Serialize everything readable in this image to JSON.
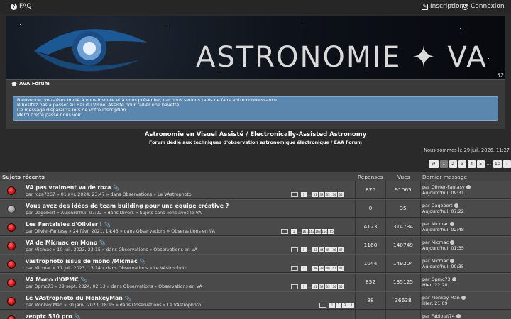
{
  "topbar": {
    "faq": "FAQ",
    "register": "Inscription",
    "login": "Connexion"
  },
  "banner": {
    "title": "ASTRONOMIE ✦ VA",
    "badge": "52"
  },
  "breadcrumb": {
    "home": "AVA Forum"
  },
  "notice": {
    "lines": [
      "Bienvenue, vous êtes invité à vous inscrire et à vous présenter, car nous serions ravis de faire votre connaissance.",
      "N'hésitez pas à passer au Bar du Visuel Assisté pour tailler une bavette",
      "Ce message disparaitra lors de votre inscription.",
      "Merci d'être passé nous voir"
    ]
  },
  "site": {
    "title": "Astronomie en Visuel Assisté / Electronically-Assisted Astronomy",
    "description": "Forum dédié aux techniques d'observation astronomique électronique / EAA Forum",
    "date": "Nous sommes le 29 juil. 2026, 11:27"
  },
  "pagination": {
    "pages": [
      "1",
      "2",
      "3",
      "4",
      "5",
      "…",
      "10"
    ],
    "current": "1"
  },
  "columns": {
    "topics": "Sujets récents",
    "replies": "Réponses",
    "views": "Vues",
    "last": "Dernier message"
  },
  "topics": [
    {
      "title": "VA pas vraiment va de roza",
      "attach": true,
      "meta": "par roza7267 » 01 avr. 2024, 23:47 » dans Observations » Le VAstrophoto",
      "pages": [
        "1",
        "…",
        "31",
        "32",
        "33",
        "34",
        "35"
      ],
      "replies": "870",
      "views": "91065",
      "last_by": "par Olivier-Fantasy",
      "last_time": "Aujourd'hui, 09:31",
      "unread": true
    },
    {
      "title": "Vous avez des idées de team building pour une équipe créative ?",
      "attach": false,
      "meta": "par Dagobert » Aujourd'hui, 07:22 » dans Divers » Sujets sans liens avec le VA",
      "pages": [],
      "replies": "0",
      "views": "35",
      "last_by": "par Dagobert",
      "last_time": "Aujourd'hui, 07:22",
      "unread": false
    },
    {
      "title": "Les Fantaisies d'Olivier !",
      "attach": true,
      "meta": "par Olivier-Fantasy » 24 févr. 2021, 14:45 » dans Observations » Observations en VA",
      "pages": [
        "1",
        "…",
        "161",
        "162",
        "163",
        "164",
        "165"
      ],
      "replies": "4123",
      "views": "314734",
      "last_by": "par Micmac",
      "last_time": "Aujourd'hui, 02:48",
      "unread": true
    },
    {
      "title": "VA de Micmac en Mono",
      "attach": true,
      "meta": "par Micmac » 10 juil. 2023, 23:15 » dans Observations » Observations en VA",
      "pages": [
        "1",
        "…",
        "43",
        "44",
        "45",
        "46",
        "47"
      ],
      "replies": "1160",
      "views": "140749",
      "last_by": "par Micmac",
      "last_time": "Aujourd'hui, 01:35",
      "unread": true
    },
    {
      "title": "vastrophoto issus de mono /Micmac",
      "attach": true,
      "meta": "par Micmac » 11 juil. 2023, 13:14 » dans Observations » Le VAstrophoto",
      "pages": [
        "1",
        "…",
        "38",
        "39",
        "40",
        "41",
        "42"
      ],
      "replies": "1044",
      "views": "149204",
      "last_by": "par Micmac",
      "last_time": "Aujourd'hui, 00:35",
      "unread": true
    },
    {
      "title": "VA Mono d'OPMC",
      "attach": true,
      "meta": "par Opmc73 » 29 sept. 2024, 02:13 » dans Observations » Observations en VA",
      "pages": [
        "1",
        "…",
        "31",
        "32",
        "33",
        "34",
        "35"
      ],
      "replies": "852",
      "views": "135125",
      "last_by": "par Opmc73",
      "last_time": "Hier, 22:28",
      "unread": true
    },
    {
      "title": "Le VAstrophoto du MonkeyMan",
      "attach": true,
      "meta": "par Monkey Man » 30 janv. 2023, 18:15 » dans Observations » Le VAstrophoto",
      "pages": [
        "1",
        "2",
        "3",
        "4"
      ],
      "replies": "88",
      "views": "36638",
      "last_by": "par Monkey Man",
      "last_time": "Hier, 21:09",
      "unread": true
    },
    {
      "title": "zeoptc 530 pro",
      "attach": true,
      "meta": "",
      "pages": [],
      "replies": "",
      "views": "",
      "last_by": "par Fabiolat74",
      "last_time": "",
      "unread": true
    }
  ]
}
